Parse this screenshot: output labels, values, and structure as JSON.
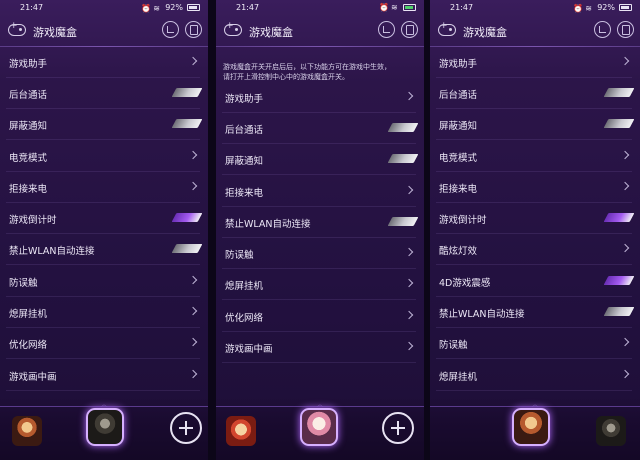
{
  "status": {
    "time": "21:47",
    "battery": "92%"
  },
  "header": {
    "title": "游戏魔盒"
  },
  "screen1": {
    "items": [
      {
        "label": "游戏助手",
        "control": "chevron"
      },
      {
        "label": "后台通话",
        "control": "toggle",
        "on": false
      },
      {
        "label": "屏蔽通知",
        "control": "toggle",
        "on": false
      },
      {
        "label": "电竞模式",
        "control": "chevron"
      },
      {
        "label": "拒接来电",
        "control": "chevron"
      },
      {
        "label": "游戏倒计时",
        "control": "toggle",
        "on": true
      },
      {
        "label": "禁止WLAN自动连接",
        "control": "toggle",
        "on": false
      },
      {
        "label": "防误触",
        "control": "chevron"
      },
      {
        "label": "熄屏挂机",
        "control": "chevron"
      },
      {
        "label": "优化网络",
        "control": "chevron"
      },
      {
        "label": "游戏画中画",
        "control": "chevron"
      }
    ]
  },
  "screen2": {
    "notice_line1": "游戏魔盒开关开启后后，以下功能方可在游戏中生效，",
    "notice_line2": "请打开上滑控制中心中的游戏魔盒开关。",
    "items": [
      {
        "label": "游戏助手",
        "control": "chevron"
      },
      {
        "label": "后台通话",
        "control": "toggle",
        "on": false
      },
      {
        "label": "屏蔽通知",
        "control": "toggle",
        "on": false
      },
      {
        "label": "拒接来电",
        "control": "chevron"
      },
      {
        "label": "禁止WLAN自动连接",
        "control": "toggle",
        "on": false
      },
      {
        "label": "防误触",
        "control": "chevron"
      },
      {
        "label": "熄屏挂机",
        "control": "chevron"
      },
      {
        "label": "优化网络",
        "control": "chevron"
      },
      {
        "label": "游戏画中画",
        "control": "chevron"
      }
    ]
  },
  "screen3": {
    "items": [
      {
        "label": "游戏助手",
        "control": "chevron"
      },
      {
        "label": "后台通话",
        "control": "toggle",
        "on": false
      },
      {
        "label": "屏蔽通知",
        "control": "toggle",
        "on": false
      },
      {
        "label": "电竞模式",
        "control": "chevron"
      },
      {
        "label": "拒接来电",
        "control": "chevron"
      },
      {
        "label": "游戏倒计时",
        "control": "toggle",
        "on": true
      },
      {
        "label": "酷炫灯效",
        "control": "chevron"
      },
      {
        "label": "4D游戏震感",
        "control": "toggle",
        "on": true
      },
      {
        "label": "禁止WLAN自动连接",
        "control": "toggle",
        "on": false
      },
      {
        "label": "防误触",
        "control": "chevron"
      },
      {
        "label": "熄屏挂机",
        "control": "chevron"
      }
    ]
  },
  "colors": {
    "accent_on": "#a45cf0",
    "background": "#2c1549"
  },
  "icons": [
    "gamepad-icon",
    "stats-icon",
    "clipboard-icon",
    "chevron-right-icon",
    "plus-icon"
  ]
}
